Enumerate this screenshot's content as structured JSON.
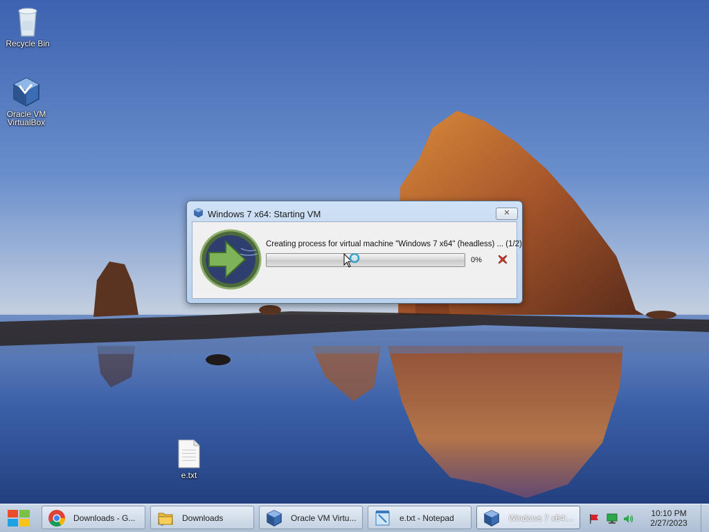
{
  "desktop": {
    "icons": [
      {
        "label": "Recycle Bin"
      },
      {
        "label": "Oracle VM VirtualBox"
      },
      {
        "label": "e.txt"
      }
    ]
  },
  "dialog": {
    "title": "Windows 7 x64: Starting VM",
    "close_label": "✕",
    "message": "Creating process for virtual machine \"Windows 7 x64\" (headless) ... (1/2)",
    "progress_percent": 0,
    "progress_text": "0%"
  },
  "taskbar": {
    "items": [
      {
        "label": "Downloads - G...",
        "icon": "chrome-icon"
      },
      {
        "label": "Downloads",
        "icon": "folder-icon"
      },
      {
        "label": "Oracle VM Virtu...",
        "icon": "virtualbox-icon"
      },
      {
        "label": "e.txt - Notepad",
        "icon": "notepad-icon"
      },
      {
        "label": "Windows 7 x64:...",
        "icon": "virtualbox-icon"
      }
    ],
    "clock_time": "10:10 PM",
    "clock_date": "2/27/2023"
  },
  "colors": {
    "progress_fill": "#2fbf3a",
    "cancel_red": "#c0392b"
  }
}
